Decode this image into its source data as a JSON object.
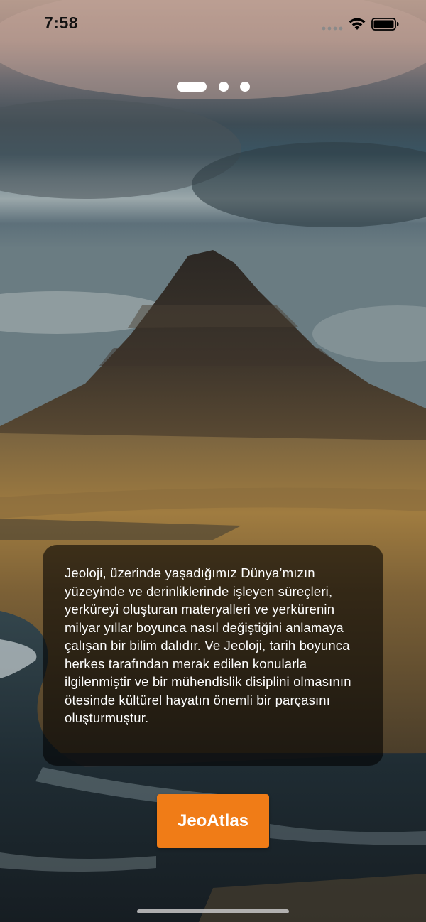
{
  "status_bar": {
    "time": "7:58"
  },
  "onboarding": {
    "page_count": 3,
    "active_page": 1,
    "description": "Jeoloji, üzerinde yaşadığımız Dünya’mızın yüzeyinde ve derinliklerinde işleyen süreçleri, yerküreyi oluşturan materyalleri ve yerkürenin milyar yıllar boyunca nasıl değiştiğini anlamaya çalışan bir bilim dalıdır. Ve Jeoloji, tarih boyunca herkes tarafından merak edilen konularla ilgilenmiştir ve bir mühendislik disiplini olmasının ötesinde kültürel hayatın önemli bir parçasını oluşturmuştur.",
    "button_label": "JeoAtlas"
  },
  "colors": {
    "accent": "#f07c17",
    "card_background": "rgba(0,0,0,0.58)"
  },
  "icons": [
    "signal-icon",
    "wifi-icon",
    "battery-icon"
  ]
}
